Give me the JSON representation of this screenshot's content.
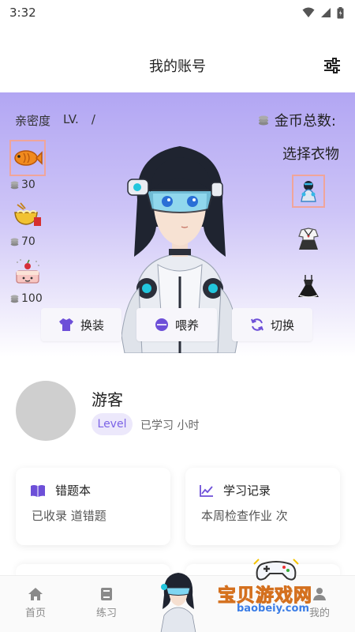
{
  "status_bar": {
    "time": "3:32"
  },
  "header": {
    "title": "我的账号"
  },
  "hero": {
    "intimacy_label": "亲密度",
    "level_label": "LV.",
    "level_separator": "/",
    "coins_total_label": "金币总数:",
    "choose_clothes_label": "选择衣物",
    "foods": [
      {
        "icon": "fish-icon",
        "price": "30"
      },
      {
        "icon": "noodle-bowl-icon",
        "price": "70"
      },
      {
        "icon": "cake-icon",
        "price": "100"
      }
    ],
    "outfits": [
      "blue-mecha-outfit-icon",
      "sailor-uniform-icon",
      "black-dress-icon"
    ],
    "actions": [
      {
        "icon": "shirt-icon",
        "label": "换装"
      },
      {
        "icon": "bowl-icon",
        "label": "喂养"
      },
      {
        "icon": "refresh-icon",
        "label": "切换"
      }
    ]
  },
  "profile": {
    "username": "游客",
    "level_badge": "Level",
    "study_time": "已学习 小时"
  },
  "cards": {
    "wrong_book": {
      "title": "错题本",
      "subtitle": "已收录 道错题"
    },
    "study_record": {
      "title": "学习记录",
      "subtitle": "本周检查作业 次"
    }
  },
  "nav": {
    "home": "首页",
    "practice": "练习",
    "mine": "我的"
  },
  "watermark": {
    "title": "宝贝游戏网",
    "url": "baobeiy.com"
  },
  "colors": {
    "accent": "#7b63e6",
    "hero_top": "#b2a6f3",
    "selected_border": "#f0a59a",
    "coin": "#888888"
  }
}
